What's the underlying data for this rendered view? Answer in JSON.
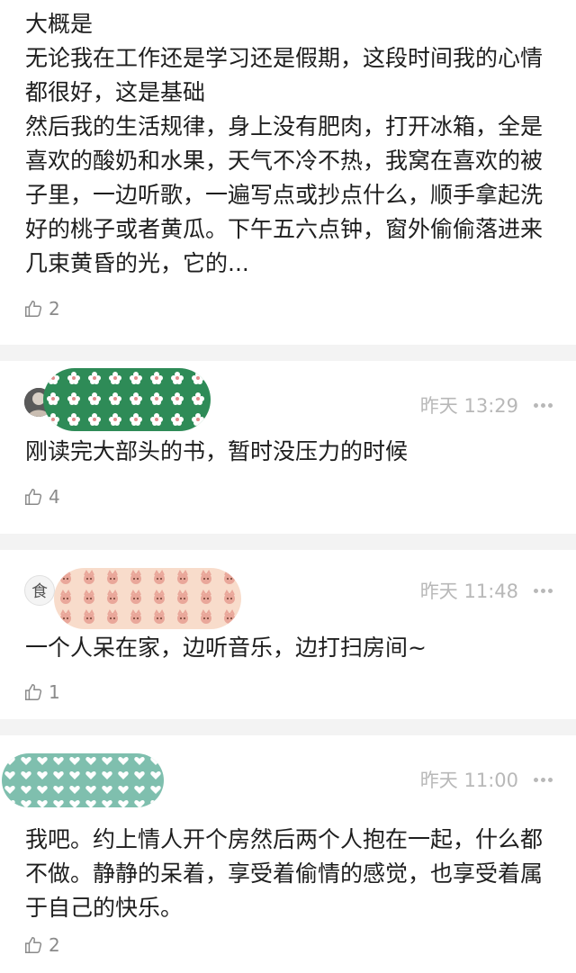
{
  "comments": [
    {
      "text": "大概是\n无论我在工作还是学习还是假期，这段时间我的心情都很好，这是基础\n然后我的生活规律，身上没有肥肉，打开冰箱，全是喜欢的酸奶和水果，天气不冷不热，我窝在喜欢的被子里，一边听歌，一遍写点或抄点什么，顺手拿起洗好的桃子或者黄瓜。下午五六点钟，窗外偷偷落进来几束黄昏的光，它的...",
      "likes": "2"
    },
    {
      "time": "昨天 13:29",
      "text": "刚读完大部头的书，暂时没压力的时候",
      "likes": "4"
    },
    {
      "time": "昨天 11:48",
      "text": "一个人呆在家，边听音乐，边打扫房间~",
      "likes": "1"
    },
    {
      "time": "昨天 11:00",
      "text": "我吧。约上情人开个房然后两个人抱在一起，什么都不做。静静的呆着，享受着偷情的感觉，也享受着属于自己的快乐。",
      "likes": "2"
    }
  ],
  "icons": {
    "like": "thumbs-up-icon",
    "more": "more-dots-icon",
    "avatar_2_text": "食",
    "colors": {
      "sticker_green": "#2e8b57",
      "sticker_peach": "#f8dccb",
      "sticker_teal": "#7fbfae"
    }
  }
}
